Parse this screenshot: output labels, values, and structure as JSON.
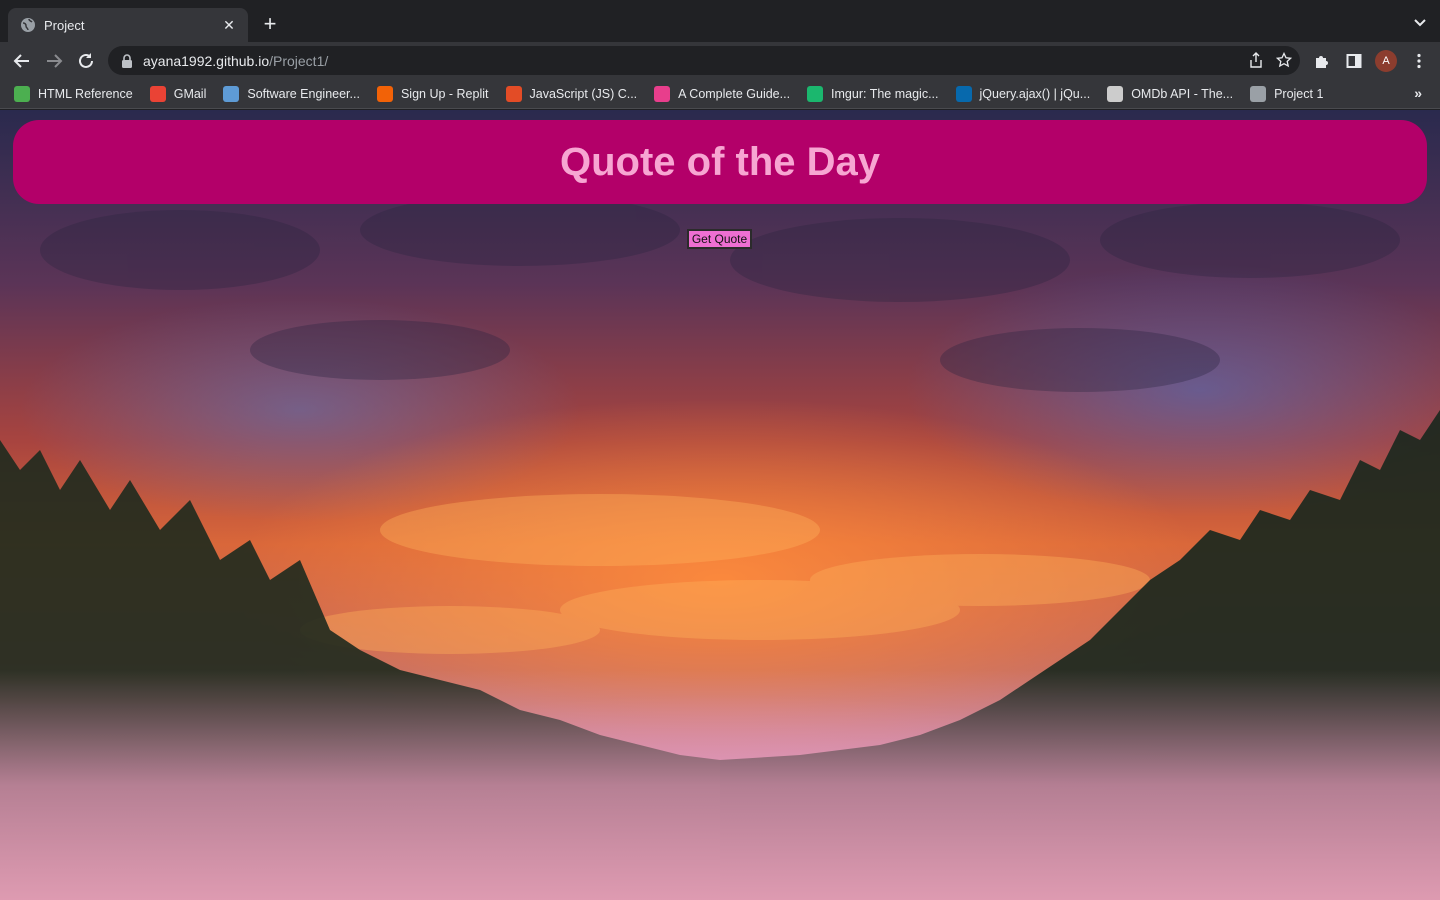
{
  "browser": {
    "tab": {
      "title": "Project",
      "favicon": "globe-icon"
    },
    "url": {
      "host": "ayana1992.github.io",
      "path": "/Project1/"
    },
    "profile_initial": "A",
    "bookmarks": [
      {
        "label": "HTML Reference",
        "icon": "w3-icon",
        "color": "#4caf50"
      },
      {
        "label": "GMail",
        "icon": "gmail-icon",
        "color": "#ea4335"
      },
      {
        "label": "Software Engineer...",
        "icon": "trello-icon",
        "color": "#5e9bd6"
      },
      {
        "label": "Sign Up - Replit",
        "icon": "replit-icon",
        "color": "#f26207"
      },
      {
        "label": "JavaScript (JS) C...",
        "icon": "codecademy-icon",
        "color": "#e34c26"
      },
      {
        "label": "A Complete Guide...",
        "icon": "csstricks-icon",
        "color": "#e83e8c"
      },
      {
        "label": "Imgur: The magic...",
        "icon": "imgur-icon",
        "color": "#1bb76e"
      },
      {
        "label": "jQuery.ajax() | jQu...",
        "icon": "jquery-icon",
        "color": "#0769ad"
      },
      {
        "label": "OMDb API - The...",
        "icon": "omdb-icon",
        "color": "#cccccc"
      },
      {
        "label": "Project 1",
        "icon": "globe-icon",
        "color": "#9aa0a6"
      }
    ]
  },
  "page": {
    "title": "Quote of the Day",
    "button_label": "Get Quote",
    "banner_color": "#b30069",
    "title_color": "#f7a6d2",
    "button_color": "#ee6fd2"
  }
}
